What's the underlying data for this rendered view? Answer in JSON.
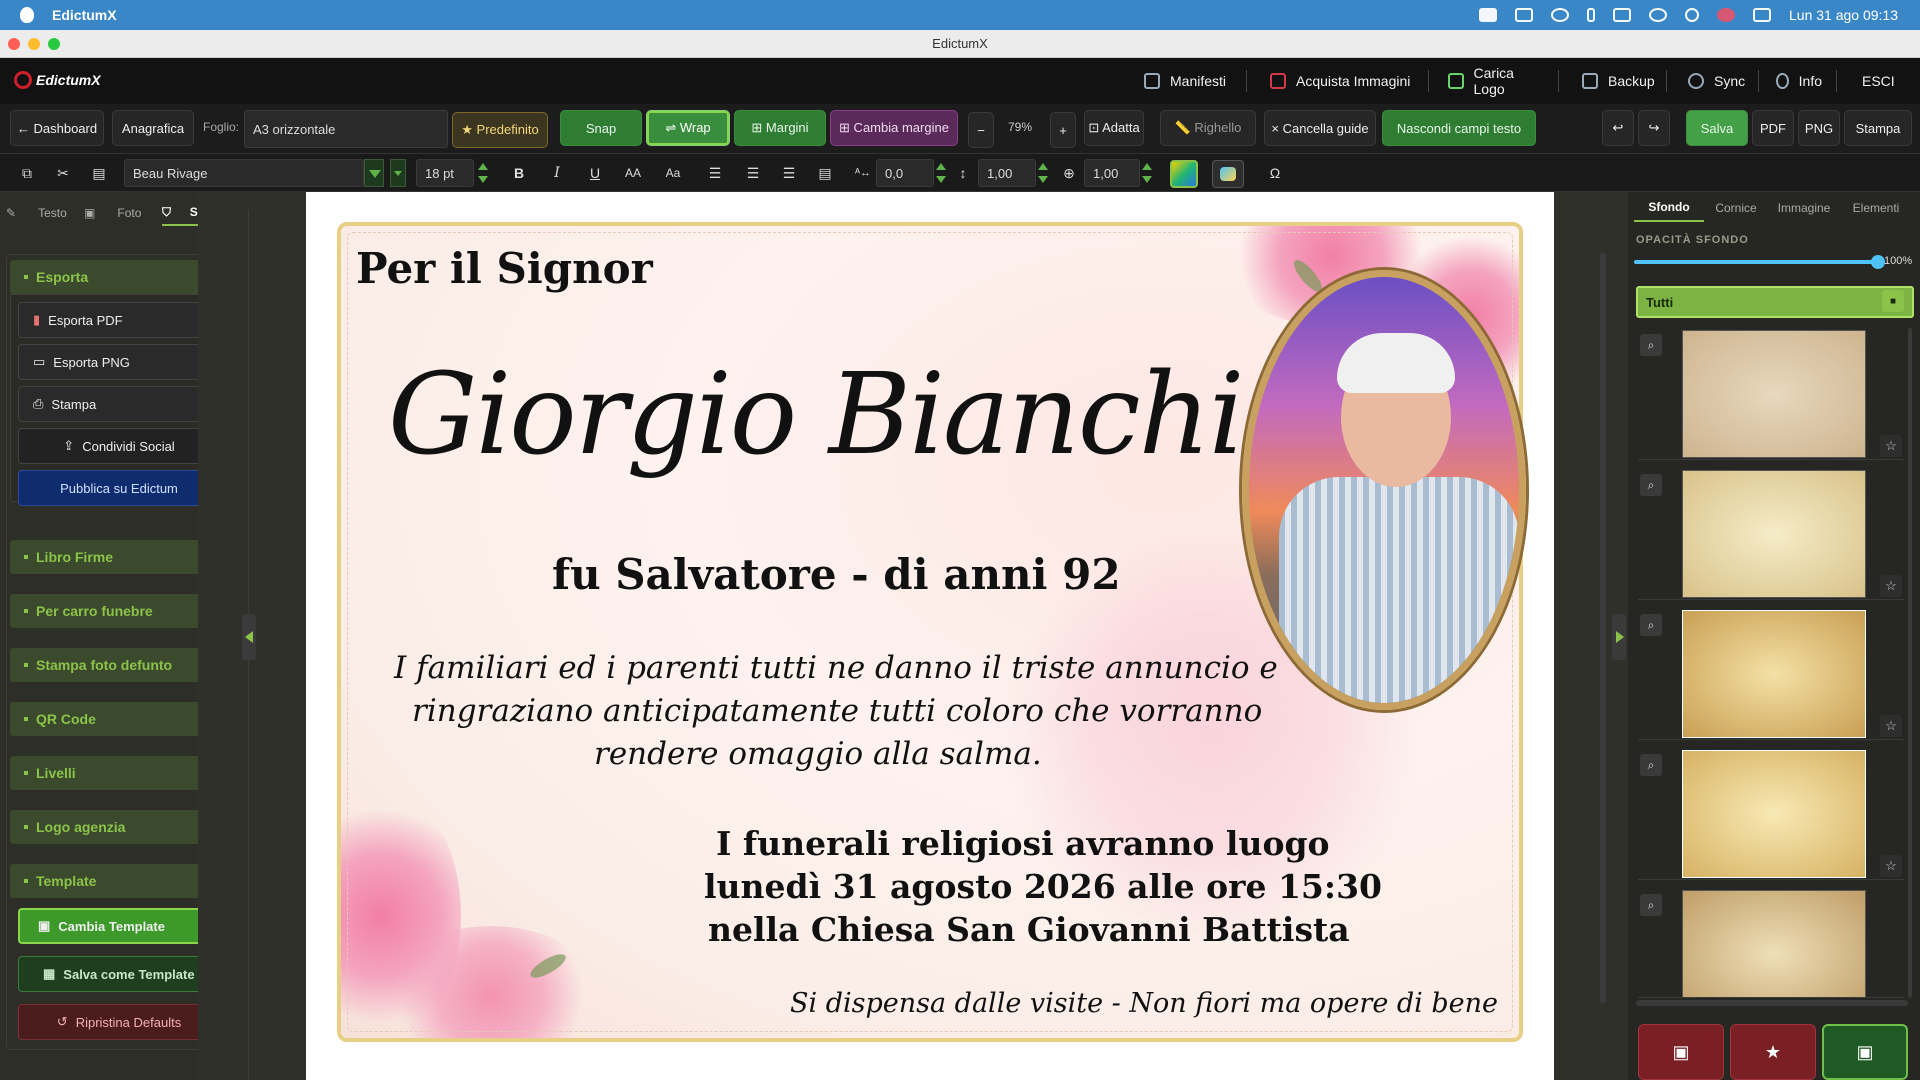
{
  "menubar": {
    "app": "EdictumX",
    "datetime": "Lun 31 ago  09:13"
  },
  "window": {
    "title": "EdictumX"
  },
  "brand": {
    "logo": "EdictumX"
  },
  "nav": {
    "manifesti": "Manifesti",
    "acquista": "Acquista Immagini",
    "carica_logo": "Carica Logo",
    "backup": "Backup",
    "sync": "Sync",
    "info": "Info",
    "esci": "ESCI"
  },
  "toolbar1": {
    "dashboard": "← Dashboard",
    "anagrafica": "Anagrafica",
    "foglio_label": "Foglio:",
    "foglio_value": "A3 orizzontale",
    "predefinito": "★ Predefinito",
    "snap": "Snap",
    "wrap": "⇌ Wrap",
    "margini": "⊞ Margini",
    "cambia_margine": "⊞ Cambia margine",
    "zoom_minus": "−",
    "zoom": "79%",
    "zoom_plus": "+",
    "adatta": "⊡ Adatta",
    "righello": "📏 Righello",
    "cancella_guide": "× Cancella guide",
    "nascondi": "Nascondi campi testo",
    "undo": "↩",
    "redo": "↪",
    "salva": "Salva",
    "pdf": "PDF",
    "png": "PNG",
    "stampa": "Stampa"
  },
  "toolbar2": {
    "font": "Beau Rivage",
    "size": "18 pt",
    "bold": "B",
    "italic": "I",
    "underline": "U",
    "caps": "AA",
    "case": "Aa",
    "letter_spacing": "0,0",
    "line_height": "1,00",
    "scale": "1,00",
    "omega": "Ω"
  },
  "left_tabs": {
    "testo": "Testo",
    "foto": "Foto",
    "servizi": "Servizi"
  },
  "left_sections": {
    "esporta": "Esporta",
    "esporta_pdf": "Esporta PDF",
    "esporta_png": "Esporta PNG",
    "stampa": "Stampa",
    "condividi": "Condividi Social",
    "pubblica": "Pubblica su Edictum",
    "libro_firme": "Libro Firme",
    "carro": "Per carro funebre",
    "stampa_foto": "Stampa foto defunto",
    "qr": "QR Code",
    "livelli": "Livelli",
    "logo_agenzia": "Logo agenzia",
    "template": "Template",
    "cambia_template": "Cambia Template",
    "salva_template": "Salva come Template",
    "ripristina": "Ripristina Defaults"
  },
  "card": {
    "per_il": "Per il Signor",
    "name": "Giorgio Bianchi",
    "fu": "fu Salvatore - di anni 92",
    "msg1": "I familiari ed i parenti tutti ne danno il triste annuncio e",
    "msg2": "ringraziano anticipatamente tutti coloro che vorranno",
    "msg3": "rendere omaggio alla salma.",
    "fun1": "I funerali religiosi avranno luogo",
    "fun2": "lunedì 31 agosto 2026 alle ore 15:30",
    "fun3": "nella Chiesa San Giovanni Battista",
    "footer": "Si dispensa dalle visite - Non fiori ma opere di bene"
  },
  "right_tabs": {
    "sfondo": "Sfondo",
    "cornice": "Cornice",
    "immagine": "Immagine",
    "elementi": "Elementi"
  },
  "right_panel": {
    "opacity_label": "OPACITÀ SFONDO",
    "opacity_value": "100%",
    "opacity_level": 1.0,
    "filter": "Tutti",
    "filter_icon": "■"
  },
  "colors": {
    "accent_green": "#8bc34a",
    "brand_red": "#d21e2a",
    "menubar_blue": "#3a87c8"
  }
}
